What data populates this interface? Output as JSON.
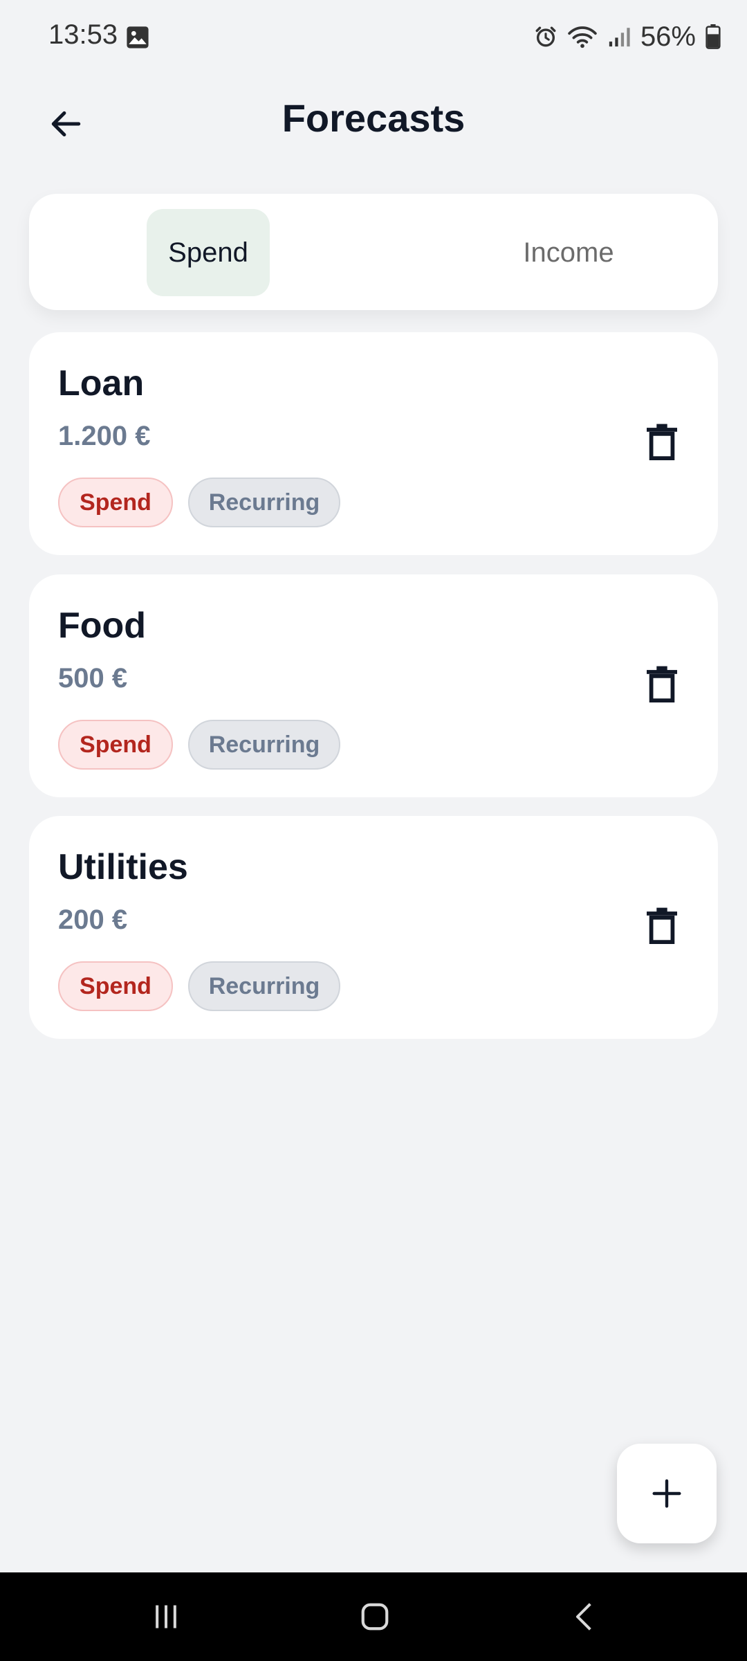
{
  "status_bar": {
    "time": "13:53",
    "battery_percent": "56%",
    "icons": [
      "image-icon",
      "alarm-icon",
      "wifi-icon",
      "signal-icon",
      "battery-icon"
    ]
  },
  "header": {
    "title": "Forecasts",
    "back_icon": "arrow-left-icon"
  },
  "tabs": [
    {
      "label": "Spend",
      "selected": true
    },
    {
      "label": "Income",
      "selected": false
    }
  ],
  "forecasts": [
    {
      "title": "Loan",
      "amount": "1.200 €",
      "type_chip": "Spend",
      "frequency_chip": "Recurring"
    },
    {
      "title": "Food",
      "amount": "500 €",
      "type_chip": "Spend",
      "frequency_chip": "Recurring"
    },
    {
      "title": "Utilities",
      "amount": "200 €",
      "type_chip": "Spend",
      "frequency_chip": "Recurring"
    }
  ],
  "fab": {
    "icon": "plus-icon"
  },
  "colors": {
    "background": "#f2f3f5",
    "selected_tab": "#e8f1eb",
    "spend_chip_bg": "#fde8e8",
    "spend_chip_text": "#b3261e",
    "recurring_chip_bg": "#e5e7eb",
    "amount_text": "#6b7a90"
  }
}
